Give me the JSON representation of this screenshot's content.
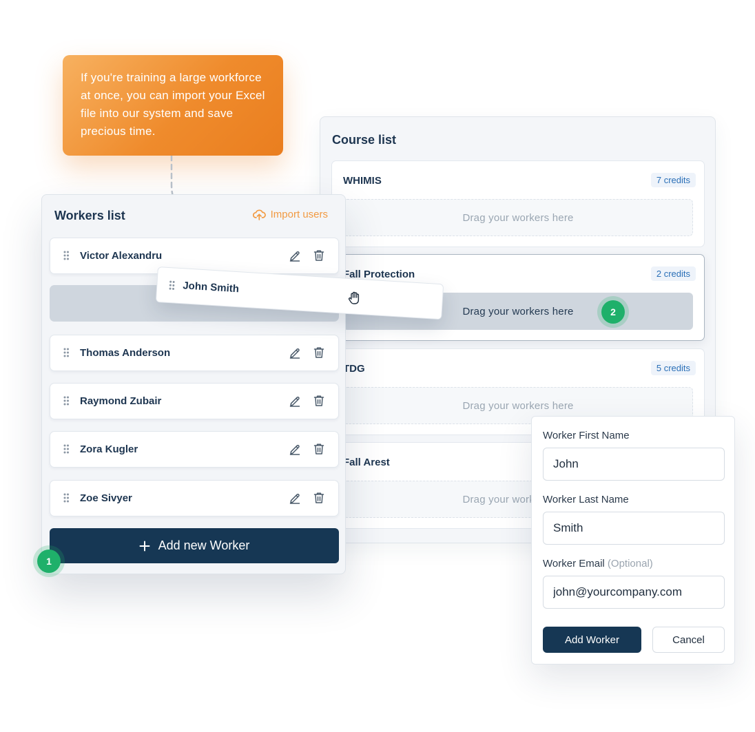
{
  "tooltip": {
    "text": "If you're training a large workforce at once, you can import your Excel file into our system and save precious time."
  },
  "workers": {
    "title": "Workers list",
    "import_label": "Import users",
    "items": [
      {
        "name": "Victor Alexandru"
      },
      {
        "name": "Thomas Anderson"
      },
      {
        "name": "Raymond Zubair"
      },
      {
        "name": "Zora Kugler"
      },
      {
        "name": "Zoe Sivyer"
      }
    ],
    "add_label": "Add new Worker",
    "step_number": "1"
  },
  "dragging": {
    "name": "John Smith"
  },
  "courses": {
    "title": "Course list",
    "items": [
      {
        "name": "WHIMIS",
        "credits": "7 credits",
        "dropzone": "Drag your workers here"
      },
      {
        "name": "Fall Protection",
        "credits": "2 credits",
        "dropzone": "Drag your workers here"
      },
      {
        "name": "TDG",
        "credits": "5 credits",
        "dropzone": "Drag your workers here"
      },
      {
        "name": "Fall Arest",
        "credits": "",
        "dropzone": "Drag your workers here"
      }
    ],
    "step_number": "2"
  },
  "form": {
    "first_name_label": "Worker First Name",
    "first_name_value": "John",
    "last_name_label": "Worker Last Name",
    "last_name_value": "Smith",
    "email_label": "Worker Email",
    "email_optional": "(Optional)",
    "email_value": "john@yourcompany.com",
    "submit_label": "Add Worker",
    "cancel_label": "Cancel"
  },
  "colors": {
    "accent_orange": "#ef8b2c",
    "primary_navy": "#163754",
    "success_green": "#1fb06a",
    "credits_blue": "#2a6fb7"
  }
}
